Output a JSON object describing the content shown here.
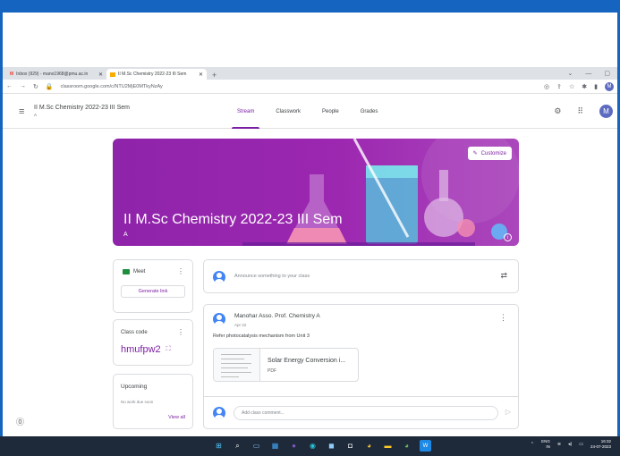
{
  "browser": {
    "tabs": [
      {
        "label": "Inbox (929) - mano1968@pmu.ac.in",
        "icon": "gmail-icon"
      },
      {
        "label": "II M.Sc Chemistry 2022-23 III Sem",
        "icon": "classroom-icon"
      }
    ],
    "url": "classroom.google.com/c/NTU2MjE0MTkyNzAy",
    "profile_initial": "M"
  },
  "header": {
    "class_title": "II M.Sc Chemistry 2022-23 III Sem",
    "class_section": "A",
    "tabs": [
      "Stream",
      "Classwork",
      "People",
      "Grades"
    ],
    "active_tab": "Stream",
    "profile_initial": "M"
  },
  "banner": {
    "title": "II M.Sc Chemistry 2022-23 III Sem",
    "section": "A",
    "customize_label": "Customize",
    "color": "#9c27b0"
  },
  "meet": {
    "label": "Meet",
    "button": "Generate link"
  },
  "class_code": {
    "label": "Class code",
    "value": "hmufpw2"
  },
  "upcoming": {
    "label": "Upcoming",
    "empty_text": "No work due soon",
    "view_all": "View all"
  },
  "announce": {
    "placeholder": "Announce something to your class"
  },
  "post": {
    "author": "Manohar Asso. Prof. Chemistry A",
    "date": "Apr 22",
    "body": "Refer photocatalysis mechanism from Unit 3",
    "attachment_title": "Solar Energy Conversion i...",
    "attachment_type": "PDF",
    "comment_placeholder": "Add class comment..."
  },
  "taskbar": {
    "lang_top": "ENG",
    "lang_bottom": "IN",
    "time": "16:32",
    "date": "24-07-2023"
  },
  "colors": {
    "accent": "#7b1fa2",
    "topbar": "#1565c0",
    "taskbar": "#1e2a3a"
  }
}
